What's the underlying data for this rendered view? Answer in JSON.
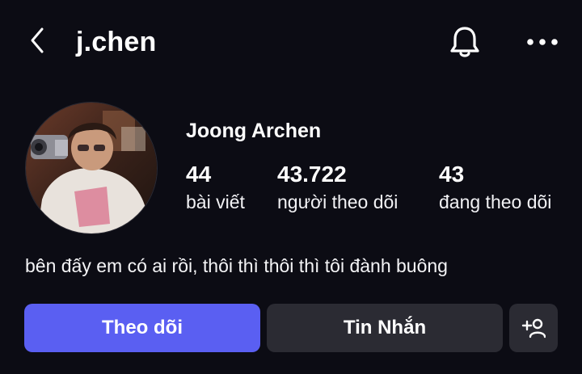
{
  "header": {
    "username": "j.chen",
    "icons": {
      "back": "chevron-left-icon",
      "notifications": "bell-icon",
      "more": "ellipsis-icon"
    }
  },
  "profile": {
    "display_name": "Joong Archen",
    "stats": {
      "posts": {
        "value": "44",
        "label": "bài viết"
      },
      "followers": {
        "value": "43.722",
        "label": "người theo dõi"
      },
      "following": {
        "value": "43",
        "label": "đang theo dõi"
      }
    },
    "bio": "bên đấy em có ai rồi, thôi thì thôi thì tôi đành buông"
  },
  "actions": {
    "follow_label": "Theo dõi",
    "message_label": "Tin Nhắn",
    "suggest_icon": "add-person-icon"
  },
  "colors": {
    "background": "#0c0c14",
    "accent": "#5a5ff2",
    "secondary_button": "#2b2b33"
  }
}
